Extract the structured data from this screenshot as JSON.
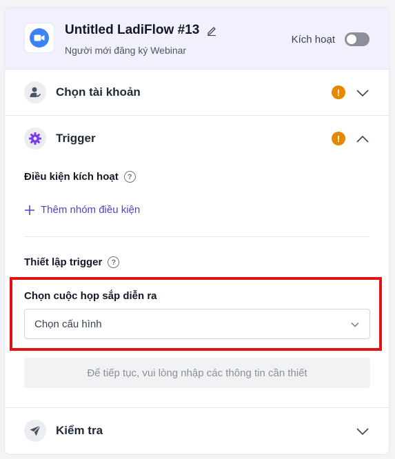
{
  "header": {
    "title": "Untitled LadiFlow #13",
    "subtitle": "Người mới đăng ký Webinar",
    "activate_label": "Kích hoạt",
    "app_icon": "video-camera-icon",
    "edit_icon": "pencil-icon"
  },
  "sections": {
    "account": {
      "title": "Chọn tài khoản",
      "icon": "user-check-icon"
    },
    "trigger": {
      "title": "Trigger",
      "icon": "gear-icon"
    },
    "test": {
      "title": "Kiểm tra",
      "icon": "send-icon"
    }
  },
  "trigger_body": {
    "conditions_label": "Điều kiện kích hoạt",
    "add_group_label": "Thêm nhóm điều kiện",
    "setup_label": "Thiết lập trigger",
    "meeting_label": "Chọn cuộc họp sắp diễn ra",
    "meeting_select_value": "Chọn cấu hình",
    "notice": "Để tiếp tục, vui lòng nhập các thông tin cần thiết"
  },
  "colors": {
    "accent": "#5b3cc4",
    "warning": "#e58a00",
    "highlight": "#e11212",
    "app_icon": "#3b82f6"
  }
}
